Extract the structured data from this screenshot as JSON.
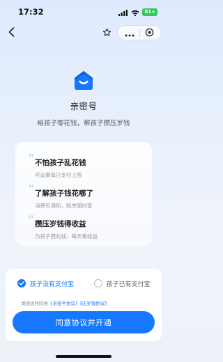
{
  "status_bar": {
    "time": "17:32",
    "battery": "81+",
    "wifi_icon": "wifi-icon",
    "signal_icon": "signal-icon"
  },
  "nav": {
    "back_icon": "chevron-left-icon",
    "favorite_icon": "star-icon",
    "more_icon": "more-dots-icon",
    "close_icon": "target-close-icon"
  },
  "hero": {
    "logo_icon": "house-smile-icon",
    "title": "亲密号",
    "subtitle": "给孩子零花钱，帮孩子攒压岁钱"
  },
  "benefits": [
    {
      "title": "不怕孩子乱花钱",
      "desc": "可设置每日支付上限"
    },
    {
      "title": "了解孩子钱花哪了",
      "desc": "消费有通知，账单随时查"
    },
    {
      "title": "攒压岁钱得收益",
      "desc": "为孩子攒的钱，每天看收益"
    }
  ],
  "options": {
    "selected": "孩子没有支付宝",
    "unselected": "孩子已有支付宝"
  },
  "agreement": {
    "prefix": "请阅读并同意",
    "link1": "《亲密号协议》",
    "link2": "《压岁钱协议》"
  },
  "cta_label": "同意协议并开通",
  "colors": {
    "accent": "#1677ff",
    "battery": "#34c759"
  }
}
